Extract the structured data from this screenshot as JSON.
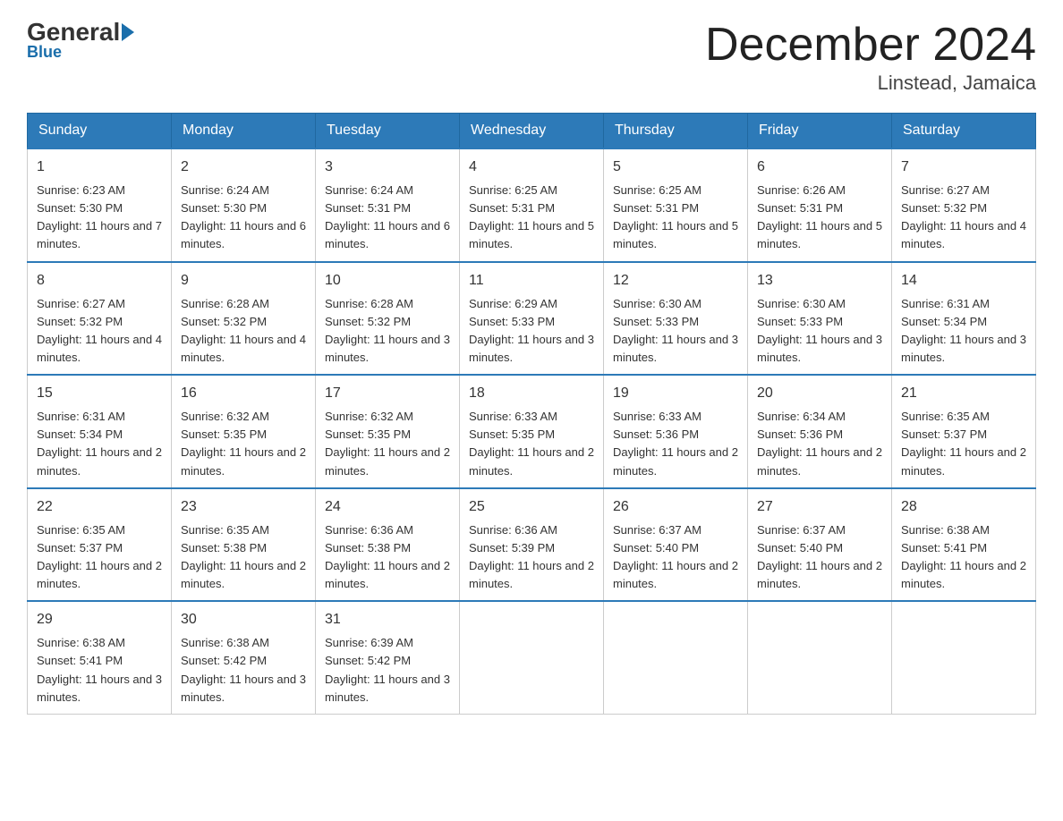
{
  "header": {
    "logo_general": "General",
    "logo_blue": "Blue",
    "month_title": "December 2024",
    "location": "Linstead, Jamaica"
  },
  "days_of_week": [
    "Sunday",
    "Monday",
    "Tuesday",
    "Wednesday",
    "Thursday",
    "Friday",
    "Saturday"
  ],
  "weeks": [
    [
      {
        "day": "1",
        "sunrise": "6:23 AM",
        "sunset": "5:30 PM",
        "daylight": "11 hours and 7 minutes."
      },
      {
        "day": "2",
        "sunrise": "6:24 AM",
        "sunset": "5:30 PM",
        "daylight": "11 hours and 6 minutes."
      },
      {
        "day": "3",
        "sunrise": "6:24 AM",
        "sunset": "5:31 PM",
        "daylight": "11 hours and 6 minutes."
      },
      {
        "day": "4",
        "sunrise": "6:25 AM",
        "sunset": "5:31 PM",
        "daylight": "11 hours and 5 minutes."
      },
      {
        "day": "5",
        "sunrise": "6:25 AM",
        "sunset": "5:31 PM",
        "daylight": "11 hours and 5 minutes."
      },
      {
        "day": "6",
        "sunrise": "6:26 AM",
        "sunset": "5:31 PM",
        "daylight": "11 hours and 5 minutes."
      },
      {
        "day": "7",
        "sunrise": "6:27 AM",
        "sunset": "5:32 PM",
        "daylight": "11 hours and 4 minutes."
      }
    ],
    [
      {
        "day": "8",
        "sunrise": "6:27 AM",
        "sunset": "5:32 PM",
        "daylight": "11 hours and 4 minutes."
      },
      {
        "day": "9",
        "sunrise": "6:28 AM",
        "sunset": "5:32 PM",
        "daylight": "11 hours and 4 minutes."
      },
      {
        "day": "10",
        "sunrise": "6:28 AM",
        "sunset": "5:32 PM",
        "daylight": "11 hours and 3 minutes."
      },
      {
        "day": "11",
        "sunrise": "6:29 AM",
        "sunset": "5:33 PM",
        "daylight": "11 hours and 3 minutes."
      },
      {
        "day": "12",
        "sunrise": "6:30 AM",
        "sunset": "5:33 PM",
        "daylight": "11 hours and 3 minutes."
      },
      {
        "day": "13",
        "sunrise": "6:30 AM",
        "sunset": "5:33 PM",
        "daylight": "11 hours and 3 minutes."
      },
      {
        "day": "14",
        "sunrise": "6:31 AM",
        "sunset": "5:34 PM",
        "daylight": "11 hours and 3 minutes."
      }
    ],
    [
      {
        "day": "15",
        "sunrise": "6:31 AM",
        "sunset": "5:34 PM",
        "daylight": "11 hours and 2 minutes."
      },
      {
        "day": "16",
        "sunrise": "6:32 AM",
        "sunset": "5:35 PM",
        "daylight": "11 hours and 2 minutes."
      },
      {
        "day": "17",
        "sunrise": "6:32 AM",
        "sunset": "5:35 PM",
        "daylight": "11 hours and 2 minutes."
      },
      {
        "day": "18",
        "sunrise": "6:33 AM",
        "sunset": "5:35 PM",
        "daylight": "11 hours and 2 minutes."
      },
      {
        "day": "19",
        "sunrise": "6:33 AM",
        "sunset": "5:36 PM",
        "daylight": "11 hours and 2 minutes."
      },
      {
        "day": "20",
        "sunrise": "6:34 AM",
        "sunset": "5:36 PM",
        "daylight": "11 hours and 2 minutes."
      },
      {
        "day": "21",
        "sunrise": "6:35 AM",
        "sunset": "5:37 PM",
        "daylight": "11 hours and 2 minutes."
      }
    ],
    [
      {
        "day": "22",
        "sunrise": "6:35 AM",
        "sunset": "5:37 PM",
        "daylight": "11 hours and 2 minutes."
      },
      {
        "day": "23",
        "sunrise": "6:35 AM",
        "sunset": "5:38 PM",
        "daylight": "11 hours and 2 minutes."
      },
      {
        "day": "24",
        "sunrise": "6:36 AM",
        "sunset": "5:38 PM",
        "daylight": "11 hours and 2 minutes."
      },
      {
        "day": "25",
        "sunrise": "6:36 AM",
        "sunset": "5:39 PM",
        "daylight": "11 hours and 2 minutes."
      },
      {
        "day": "26",
        "sunrise": "6:37 AM",
        "sunset": "5:40 PM",
        "daylight": "11 hours and 2 minutes."
      },
      {
        "day": "27",
        "sunrise": "6:37 AM",
        "sunset": "5:40 PM",
        "daylight": "11 hours and 2 minutes."
      },
      {
        "day": "28",
        "sunrise": "6:38 AM",
        "sunset": "5:41 PM",
        "daylight": "11 hours and 2 minutes."
      }
    ],
    [
      {
        "day": "29",
        "sunrise": "6:38 AM",
        "sunset": "5:41 PM",
        "daylight": "11 hours and 3 minutes."
      },
      {
        "day": "30",
        "sunrise": "6:38 AM",
        "sunset": "5:42 PM",
        "daylight": "11 hours and 3 minutes."
      },
      {
        "day": "31",
        "sunrise": "6:39 AM",
        "sunset": "5:42 PM",
        "daylight": "11 hours and 3 minutes."
      },
      null,
      null,
      null,
      null
    ]
  ]
}
